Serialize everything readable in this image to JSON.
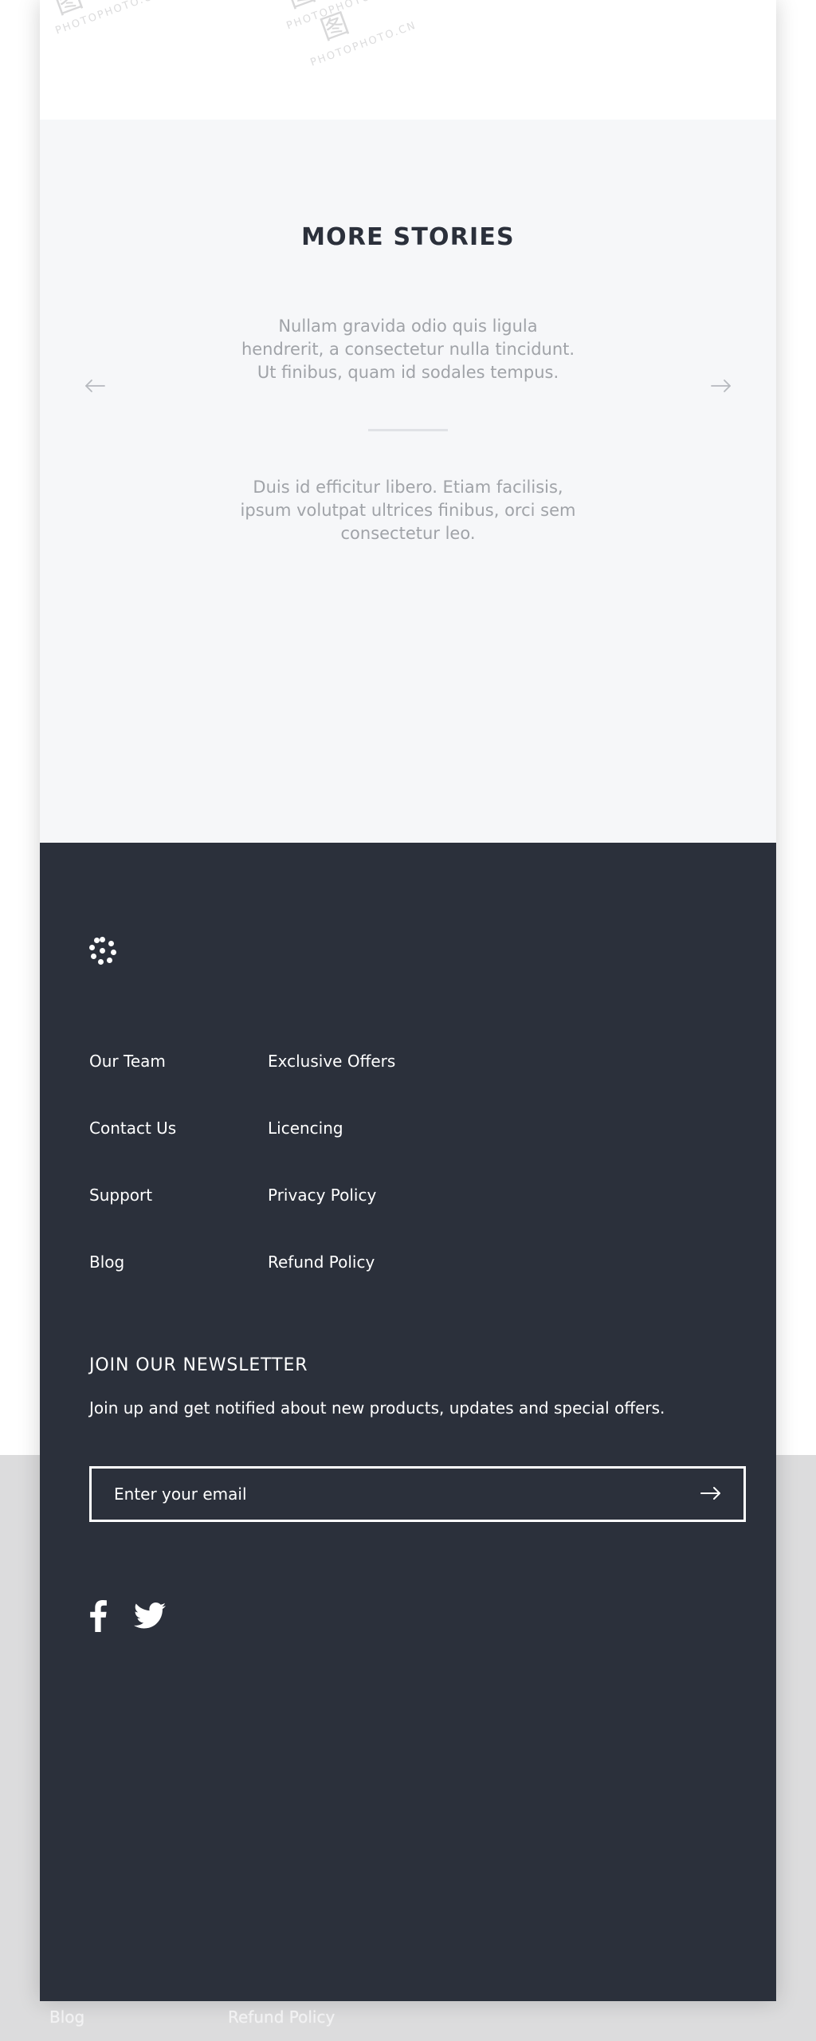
{
  "watermarks": {
    "label": "PHOTOPHOTO.CN",
    "glyph": "图"
  },
  "stories": {
    "heading": "MORE STORIES",
    "prev_label": "arrow-left",
    "next_label": "arrow-right",
    "quotes": [
      "Nullam gravida odio quis ligula hendrerit, a consectetur nulla tincidunt. Ut finibus, quam id sodales tempus.",
      "Duis id efficitur libero. Etiam facilisis, ipsum volutpat ultrices finibus, orci sem consectetur leo."
    ]
  },
  "footer": {
    "logo": "dot-grid-logo",
    "background_color": "#2b303b",
    "columns": [
      {
        "links": [
          "Our Team",
          "Contact Us",
          "Support",
          "Blog"
        ]
      },
      {
        "links": [
          "Exclusive Offers",
          "Licencing",
          "Privacy Policy",
          "Refund Policy"
        ]
      }
    ],
    "newsletter": {
      "title": "JOIN OUR NEWSLETTER",
      "description": "Join up and get notified about new products, updates and special offers.",
      "email_placeholder": "Enter your email",
      "email_value": "",
      "submit_label": "arrow-right"
    },
    "socials": [
      {
        "name": "facebook",
        "glyph": "f"
      },
      {
        "name": "twitter",
        "glyph": "t"
      }
    ]
  },
  "ghost_layer": {
    "links": [
      "Blog",
      "Refund Policy"
    ]
  }
}
